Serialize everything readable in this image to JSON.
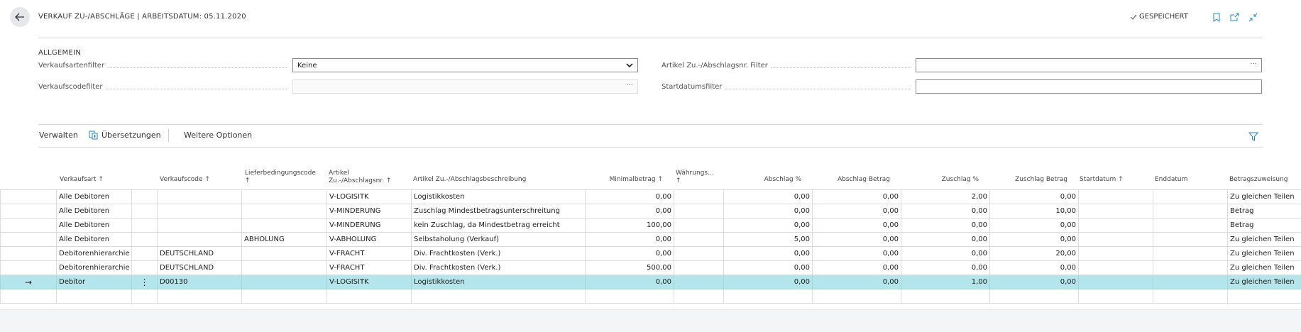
{
  "header": {
    "title": "VERKAUF ZU-/ABSCHLÄGE | ARBEITSDATUM: 05.11.2020",
    "saved_label": "GESPEICHERT"
  },
  "general": {
    "section_title": "ALLGEMEIN",
    "fields": {
      "verkaufsartenfilter_label": "Verkaufsartenfilter",
      "verkaufsartenfilter_value": "Keine",
      "verkaufscodefilter_label": "Verkaufscodefilter",
      "verkaufscodefilter_value": "",
      "artikel_filter_label": "Artikel Zu.-/Abschlagsnr. Filter",
      "artikel_filter_value": "",
      "startdatumsfilter_label": "Startdatumsfilter",
      "startdatumsfilter_value": ""
    },
    "ellipsis": "···"
  },
  "toolbar": {
    "manage": "Verwalten",
    "translations": "Übersetzungen",
    "more_options": "Weitere Optionen"
  },
  "columns": {
    "verkaufsart": "Verkaufsart ↑",
    "verkaufscode": "Verkaufscode ↑",
    "lieferbedingungscode_1": "Lieferbedingungscode",
    "lieferbedingungscode_2": "↑",
    "artikel_nr_1": "Artikel",
    "artikel_nr_2": "Zu.-/Abschlagsnr. ↑",
    "beschreibung": "Artikel Zu.-/Abschlagsbeschreibung",
    "minimalbetrag": "Minimalbetrag ↑",
    "waehrung_1": "Währungs...",
    "waehrung_2": "↑",
    "abschlag_pct": "Abschlag %",
    "abschlag_betrag": "Abschlag Betrag",
    "zuschlag_pct": "Zuschlag %",
    "zuschlag_betrag": "Zuschlag Betrag",
    "startdatum": "Startdatum ↑",
    "enddatum": "Enddatum",
    "betragszuweisung": "Betragszuweisung"
  },
  "rows": [
    {
      "marker": "",
      "menu": "",
      "art": "Alle Debitoren",
      "code": "",
      "liefer": "",
      "nr": "V-LOGISITK",
      "desc": "Logistikkosten",
      "min": "0,00",
      "wae": "",
      "abp": "0,00",
      "abb": "0,00",
      "zup": "2,00",
      "zub": "0,00",
      "start": "",
      "end": "",
      "zuw": "Zu gleichen Teilen"
    },
    {
      "marker": "",
      "menu": "",
      "art": "Alle Debitoren",
      "code": "",
      "liefer": "",
      "nr": "V-MINDERUNG",
      "desc": "Zuschlag Mindestbetragsunterschreitung",
      "min": "0,00",
      "wae": "",
      "abp": "0,00",
      "abb": "0,00",
      "zup": "0,00",
      "zub": "10,00",
      "start": "",
      "end": "",
      "zuw": "Betrag"
    },
    {
      "marker": "",
      "menu": "",
      "art": "Alle Debitoren",
      "code": "",
      "liefer": "",
      "nr": "V-MINDERUNG",
      "desc": "kein Zuschlag, da Mindestbetrag erreicht",
      "min": "100,00",
      "wae": "",
      "abp": "0,00",
      "abb": "0,00",
      "zup": "0,00",
      "zub": "0,00",
      "start": "",
      "end": "",
      "zuw": "Betrag"
    },
    {
      "marker": "",
      "menu": "",
      "art": "Alle Debitoren",
      "code": "",
      "liefer": "ABHOLUNG",
      "nr": "V-ABHOLUNG",
      "desc": "Selbstaholung (Verkauf)",
      "min": "0,00",
      "wae": "",
      "abp": "5,00",
      "abb": "0,00",
      "zup": "0,00",
      "zub": "0,00",
      "start": "",
      "end": "",
      "zuw": "Zu gleichen Teilen"
    },
    {
      "marker": "",
      "menu": "",
      "art": "Debitorenhierarchie",
      "code": "DEUTSCHLAND",
      "liefer": "",
      "nr": "V-FRACHT",
      "desc": "Div. Frachtkosten (Verk.)",
      "min": "0,00",
      "wae": "",
      "abp": "0,00",
      "abb": "0,00",
      "zup": "0,00",
      "zub": "20,00",
      "start": "",
      "end": "",
      "zuw": "Zu gleichen Teilen"
    },
    {
      "marker": "",
      "menu": "",
      "art": "Debitorenhierarchie",
      "code": "DEUTSCHLAND",
      "liefer": "",
      "nr": "V-FRACHT",
      "desc": "Div. Frachtkosten (Verk.)",
      "min": "500,00",
      "wae": "",
      "abp": "0,00",
      "abb": "0,00",
      "zup": "0,00",
      "zub": "0,00",
      "start": "",
      "end": "",
      "zuw": "Zu gleichen Teilen"
    },
    {
      "marker": "→",
      "menu": "⋮",
      "art": "Debitor",
      "code": "D00130",
      "liefer": "",
      "nr": "V-LOGISITK",
      "desc": "Logistikkosten",
      "min": "0,00",
      "wae": "",
      "abp": "0,00",
      "abb": "0,00",
      "zup": "1,00",
      "zub": "0,00",
      "start": "",
      "end": "",
      "zuw": "Zu gleichen Teilen"
    },
    {
      "marker": "",
      "menu": "",
      "art": "",
      "code": "",
      "liefer": "",
      "nr": "",
      "desc": "",
      "min": "",
      "wae": "",
      "abp": "",
      "abb": "",
      "zup": "",
      "zub": "",
      "start": "",
      "end": "",
      "zuw": ""
    }
  ],
  "colors": {
    "selected_row": "#b3e5ea",
    "accent": "#00a3b4"
  }
}
